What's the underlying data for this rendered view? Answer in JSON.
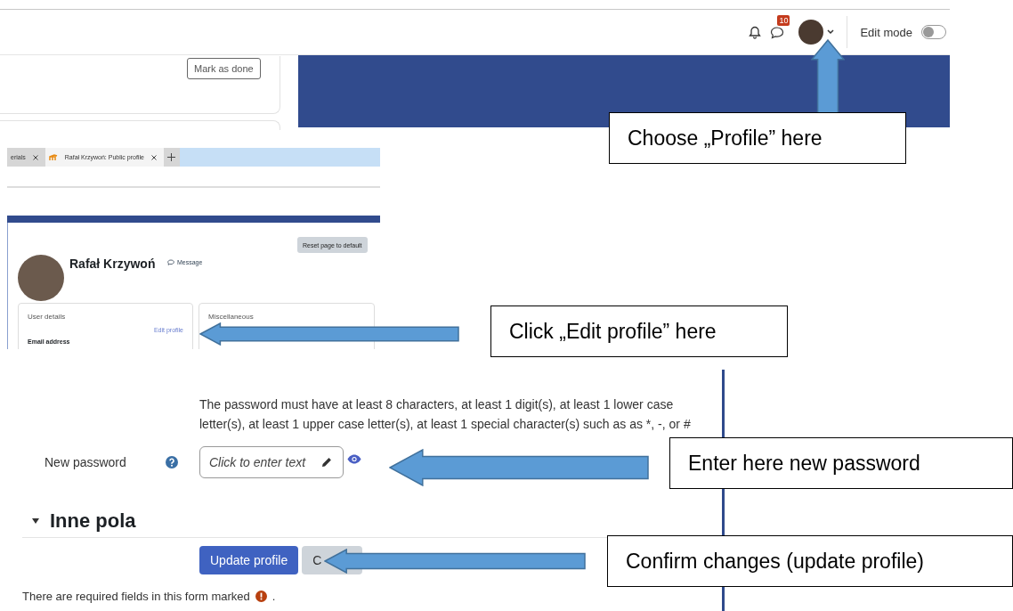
{
  "top_bar": {
    "notification_badge": "10",
    "edit_mode": {
      "label": "Edit mode",
      "on": false
    },
    "mark_as_done": "Mark as done"
  },
  "browser": {
    "tabs": [
      {
        "label": "erials",
        "selected": false
      },
      {
        "label": "Rafał Krzywoń: Public profile",
        "selected": true
      }
    ]
  },
  "profile": {
    "reset_button": "Reset page to default",
    "name": "Rafał Krzywoń",
    "message_link": "Message",
    "cards": [
      {
        "title": "User details",
        "link": "Edit profile",
        "field": "Email address"
      },
      {
        "title": "Miscellaneous"
      }
    ]
  },
  "password": {
    "rules": "The password must have at least 8 characters, at least 1 digit(s), at least 1 lower case letter(s), at least 1 upper case letter(s), at least 1 special character(s) such as as *, -, or #",
    "label": "New password",
    "placeholder": "Click to enter text"
  },
  "section_heading": "Inne pola",
  "buttons": [
    {
      "label": "Update profile",
      "kind": "primary"
    },
    {
      "label": "C",
      "kind": "secondary"
    }
  ],
  "required_note": {
    "text": "There are required fields in this form marked",
    "after": "."
  },
  "callouts": [
    "Choose „Profile” here",
    "Click „Edit profile” here",
    "Enter here new password",
    "Confirm changes (update profile)"
  ]
}
